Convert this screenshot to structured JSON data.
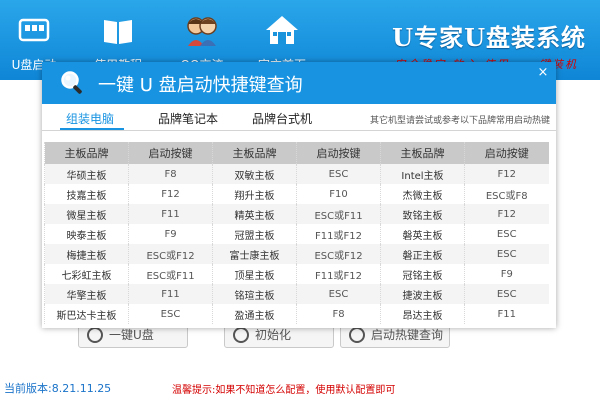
{
  "nav": [
    {
      "label": "U盘启动",
      "icon": "usb-drive-icon"
    },
    {
      "label": "使用教程",
      "icon": "book-icon"
    },
    {
      "label": "QQ交流",
      "icon": "people-icon"
    },
    {
      "label": "官方首页",
      "icon": "home-icon"
    }
  ],
  "brand": {
    "title": "U专家U盘装系统",
    "slogan": "安全稳定 放心 使用 · 一键装机"
  },
  "background": {
    "buttons": [
      "一键U盘",
      "初始化",
      "启动热键查询"
    ],
    "version_label": "当前版本:8.21.11.25",
    "tip": "温馨提示:如果不知道怎么配置，使用默认配置即可"
  },
  "dialog": {
    "title": "一键 U 盘启动快捷键查询",
    "close": "×",
    "tabs": [
      "组装电脑",
      "品牌笔记本",
      "品牌台式机"
    ],
    "active_tab": 0,
    "note": "其它机型请尝试或参考以下品牌常用启动热键"
  },
  "table": {
    "headers": [
      "主板品牌",
      "启动按键",
      "主板品牌",
      "启动按键",
      "主板品牌",
      "启动按键"
    ],
    "rows": [
      [
        "华硕主板",
        "F8",
        "双敏主板",
        "ESC",
        "Intel主板",
        "F12"
      ],
      [
        "技嘉主板",
        "F12",
        "翔升主板",
        "F10",
        "杰微主板",
        "ESC或F8"
      ],
      [
        "微星主板",
        "F11",
        "精英主板",
        "ESC或F11",
        "致铭主板",
        "F12"
      ],
      [
        "映泰主板",
        "F9",
        "冠盟主板",
        "F11或F12",
        "磐英主板",
        "ESC"
      ],
      [
        "梅捷主板",
        "ESC或F12",
        "富士康主板",
        "ESC或F12",
        "磐正主板",
        "ESC"
      ],
      [
        "七彩虹主板",
        "ESC或F11",
        "顶星主板",
        "F11或F12",
        "冠铭主板",
        "F9"
      ],
      [
        "华擎主板",
        "F11",
        "铭瑄主板",
        "ESC",
        "捷波主板",
        "ESC"
      ],
      [
        "斯巴达卡主板",
        "ESC",
        "盈通主板",
        "F8",
        "昂达主板",
        "F11"
      ]
    ]
  },
  "colors": {
    "accent": "#1793e2",
    "topbar": "#1a93dd",
    "warning": "#d40000",
    "version": "#1a73c9"
  }
}
